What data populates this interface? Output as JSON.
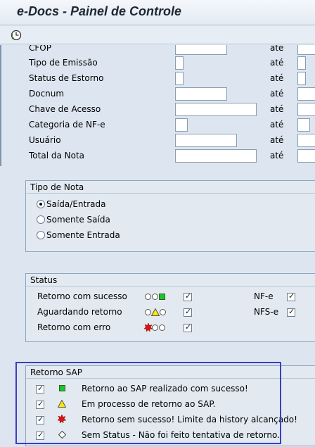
{
  "window": {
    "title": "e-Docs - Painel de Controle"
  },
  "toolbar": {
    "execute_icon": "execute-clock-icon"
  },
  "selection": {
    "ate_label": "até",
    "rows": [
      {
        "label": "CFOP"
      },
      {
        "label": "Tipo de Emissão"
      },
      {
        "label": "Status de Estorno"
      },
      {
        "label": "Docnum"
      },
      {
        "label": "Chave de Acesso"
      },
      {
        "label": "Categoria de NF-e"
      },
      {
        "label": "Usuário"
      },
      {
        "label": "Total da Nota"
      }
    ]
  },
  "tipo_nota": {
    "title": "Tipo de Nota",
    "options": [
      {
        "label": "Saída/Entrada",
        "selected": true
      },
      {
        "label": "Somente Saída",
        "selected": false
      },
      {
        "label": "Somente Entrada",
        "selected": false
      }
    ]
  },
  "status": {
    "title": "Status",
    "rows": [
      {
        "label": "Retorno com sucesso",
        "light": "green",
        "checked": true
      },
      {
        "label": "Aguardando retorno",
        "light": "yellow",
        "checked": true
      },
      {
        "label": "Retorno com erro",
        "light": "red",
        "checked": true
      }
    ],
    "doc_types": [
      {
        "label": "NF-e",
        "checked": true
      },
      {
        "label": "NFS-e",
        "checked": true
      }
    ]
  },
  "retorno_sap": {
    "title": "Retorno SAP",
    "rows": [
      {
        "checked": true,
        "icon": "green-square-icon",
        "text": "Retorno ao SAP realizado com sucesso!"
      },
      {
        "checked": true,
        "icon": "yellow-triangle-icon",
        "text": "Em processo de retorno ao SAP."
      },
      {
        "checked": true,
        "icon": "red-burst-icon",
        "text": "Retorno sem sucesso! Limite da history alcançado!"
      },
      {
        "checked": true,
        "icon": "diamond-icon",
        "text": "Sem Status - Não foi feito tentativa de retorno."
      }
    ]
  },
  "colors": {
    "background": "#dde6f0",
    "highlight_frame": "#3b3fc2",
    "status_green": "#1bc52b",
    "status_yellow": "#ffe800",
    "status_red": "#e01010"
  }
}
